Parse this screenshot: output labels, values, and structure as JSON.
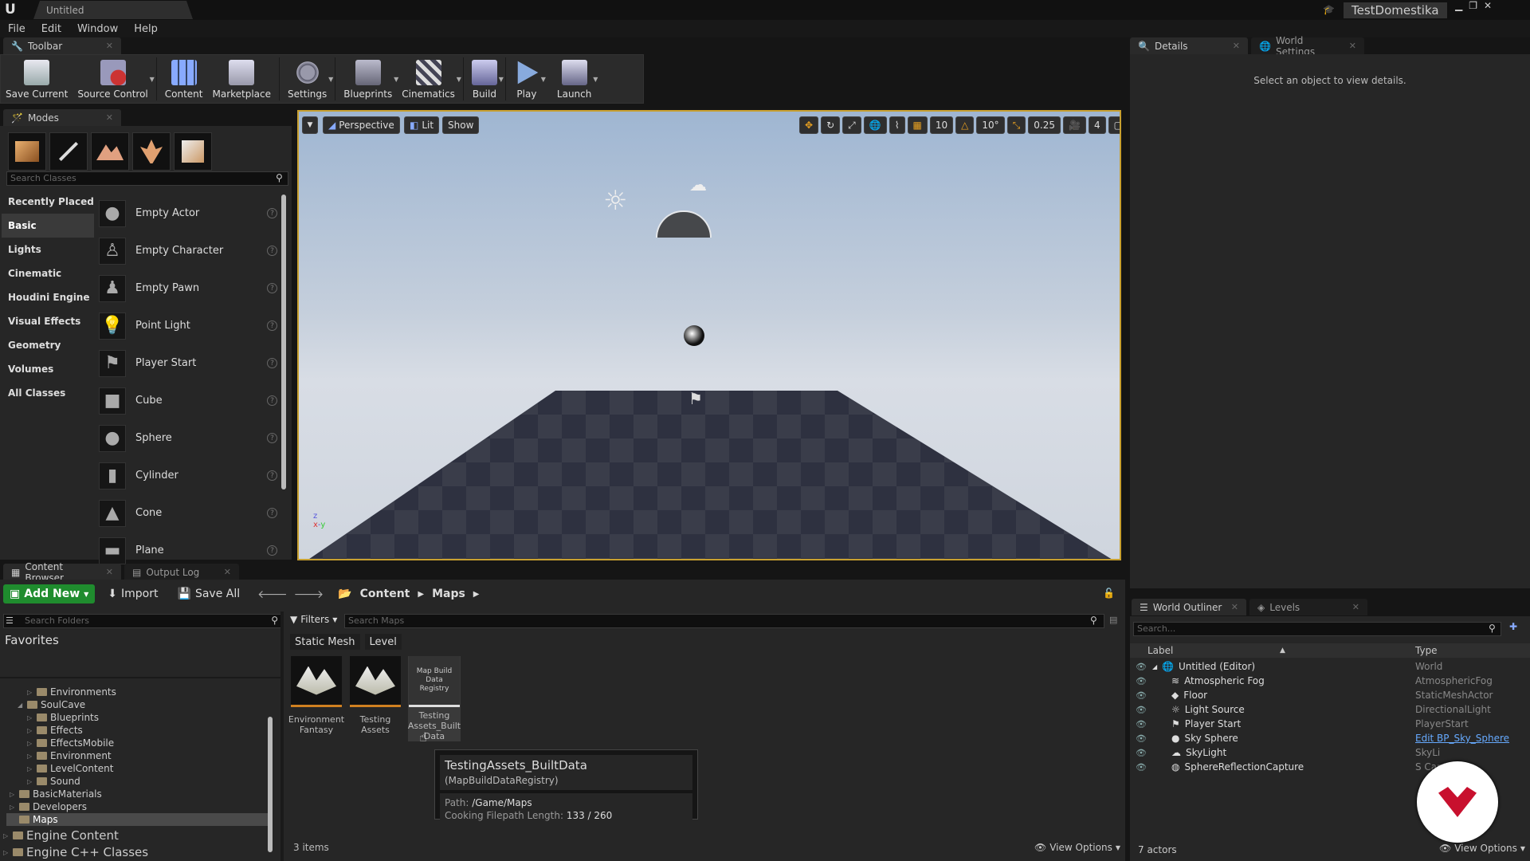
{
  "title_bar": {
    "doc_tab": "Untitled",
    "project_name": "TestDomestika"
  },
  "menu": [
    "File",
    "Edit",
    "Window",
    "Help"
  ],
  "toolbar": {
    "tab_label": "Toolbar",
    "buttons": [
      "Save Current",
      "Source Control",
      "Content",
      "Marketplace",
      "Settings",
      "Blueprints",
      "Cinematics",
      "Build",
      "Play",
      "Launch"
    ]
  },
  "modes": {
    "tab_label": "Modes",
    "search_placeholder": "Search Classes",
    "categories": [
      "Recently Placed",
      "Basic",
      "Lights",
      "Cinematic",
      "Houdini Engine",
      "Visual Effects",
      "Geometry",
      "Volumes",
      "All Classes"
    ],
    "selected_category": "Basic",
    "classes": [
      "Empty Actor",
      "Empty Character",
      "Empty Pawn",
      "Point Light",
      "Player Start",
      "Cube",
      "Sphere",
      "Cylinder",
      "Cone",
      "Plane"
    ]
  },
  "viewport": {
    "perspective": "Perspective",
    "lit": "Lit",
    "show": "Show",
    "grid_snap": "10",
    "rot_snap": "10°",
    "scale_snap": "0.25",
    "camera_speed": "4"
  },
  "details": {
    "tab_details": "Details",
    "tab_world_settings": "World Settings",
    "empty_message": "Select an object to view details."
  },
  "content_browser": {
    "tab_label": "Content Browser",
    "tab_output": "Output Log",
    "add_new": "Add New",
    "import": "Import",
    "save_all": "Save All",
    "breadcrumb": [
      "Content",
      "Maps"
    ],
    "search_folders": "Search Folders",
    "favorites": "Favorites",
    "filters": "Filters",
    "search_maps": "Search Maps",
    "filter_chips": [
      "Static Mesh",
      "Level"
    ],
    "folders": [
      {
        "name": "Environments",
        "indent": 2,
        "expanded": false
      },
      {
        "name": "SoulCave",
        "indent": 1,
        "expanded": true
      },
      {
        "name": "Blueprints",
        "indent": 2,
        "expanded": false
      },
      {
        "name": "Effects",
        "indent": 2,
        "expanded": false
      },
      {
        "name": "EffectsMobile",
        "indent": 2,
        "expanded": false
      },
      {
        "name": "Environment",
        "indent": 2,
        "expanded": false
      },
      {
        "name": "LevelContent",
        "indent": 2,
        "expanded": false
      },
      {
        "name": "Sound",
        "indent": 2,
        "expanded": false
      },
      {
        "name": "BasicMaterials",
        "indent": 1,
        "expanded": false
      },
      {
        "name": "Developers",
        "indent": 1,
        "expanded": false
      },
      {
        "name": "Maps",
        "indent": 1,
        "expanded": false,
        "selected": true
      }
    ],
    "engine_content": "Engine Content",
    "engine_cpp": "Engine C++ Classes",
    "assets": [
      {
        "line1": "Environment",
        "line2": "Fantasy"
      },
      {
        "line1": "Testing",
        "line2": "Assets"
      },
      {
        "line1": "Testing",
        "line2": "Assets_Built",
        "line3": "Data",
        "thumb_text": "Map Build Data Registry"
      }
    ],
    "item_count": "3 items",
    "view_options": "View Options",
    "tooltip": {
      "title": "TestingAssets_BuiltData",
      "type": "(MapBuildDataRegistry)",
      "path_label": "Path:",
      "path_value": "/Game/Maps",
      "cook_label": "Cooking Filepath Length:",
      "cook_value": "133 / 260"
    }
  },
  "outliner": {
    "tab_label": "World Outliner",
    "tab_levels": "Levels",
    "search_placeholder": "Search...",
    "col_label": "Label",
    "col_type": "Type",
    "rows": [
      {
        "label": "Untitled (Editor)",
        "type": "World",
        "indent": 0
      },
      {
        "label": "Atmospheric Fog",
        "type": "AtmosphericFog",
        "indent": 1
      },
      {
        "label": "Floor",
        "type": "StaticMeshActor",
        "indent": 1
      },
      {
        "label": "Light Source",
        "type": "DirectionalLight",
        "indent": 1
      },
      {
        "label": "Player Start",
        "type": "PlayerStart",
        "indent": 1
      },
      {
        "label": "Sky Sphere",
        "type": "Edit BP_Sky_Sphere",
        "indent": 1,
        "link": true
      },
      {
        "label": "SkyLight",
        "type": "SkyLi",
        "indent": 1
      },
      {
        "label": "SphereReflectionCapture",
        "type": "S          Capture",
        "indent": 1
      }
    ],
    "actor_count": "7 actors",
    "view_options": "View Options"
  },
  "colors": {
    "accent_green": "#1f8c2e",
    "viewport_border": "#c8a030",
    "watermark_red": "#c8102e"
  }
}
